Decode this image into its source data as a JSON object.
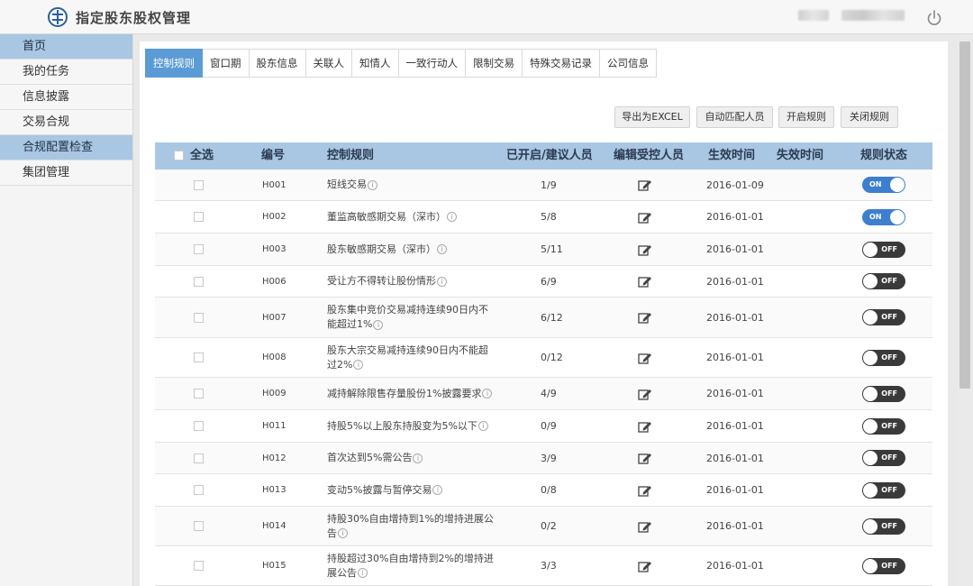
{
  "app": {
    "title": "指定股东股权管理"
  },
  "sidebar": {
    "items": [
      {
        "label": "首页",
        "active": true
      },
      {
        "label": "我的任务",
        "active": false
      },
      {
        "label": "信息披露",
        "active": false
      },
      {
        "label": "交易合规",
        "active": false
      },
      {
        "label": "合规配置检查",
        "active": true
      },
      {
        "label": "集团管理",
        "active": false
      }
    ]
  },
  "tabs": [
    {
      "label": "控制规则",
      "active": true
    },
    {
      "label": "窗口期"
    },
    {
      "label": "股东信息"
    },
    {
      "label": "关联人"
    },
    {
      "label": "知情人"
    },
    {
      "label": "一致行动人"
    },
    {
      "label": "限制交易"
    },
    {
      "label": "特殊交易记录"
    },
    {
      "label": "公司信息"
    }
  ],
  "toolbar": {
    "export": "导出为EXCEL",
    "auto_match": "自动匹配人员",
    "enable": "开启规则",
    "disable": "关闭规则"
  },
  "table": {
    "headers": {
      "select_all": "全选",
      "code": "编号",
      "rule": "控制规则",
      "count": "已开启/建议人员",
      "edit": "编辑受控人员",
      "effective": "生效时间",
      "expire": "失效时间",
      "status": "规则状态"
    },
    "rows": [
      {
        "code": "H001",
        "rule": "短线交易",
        "count": "1/9",
        "effective": "2016-01-09",
        "expire": "",
        "status": "ON"
      },
      {
        "code": "H002",
        "rule": "董监高敏感期交易（深市）",
        "count": "5/8",
        "effective": "2016-01-01",
        "expire": "",
        "status": "ON"
      },
      {
        "code": "H003",
        "rule": "股东敏感期交易（深市）",
        "count": "5/11",
        "effective": "2016-01-01",
        "expire": "",
        "status": "OFF"
      },
      {
        "code": "H006",
        "rule": "受让方不得转让股份情形",
        "count": "6/9",
        "effective": "2016-01-01",
        "expire": "",
        "status": "OFF"
      },
      {
        "code": "H007",
        "rule": "股东集中竞价交易减持连续90日内不能超过1%",
        "count": "6/12",
        "effective": "2016-01-01",
        "expire": "",
        "status": "OFF"
      },
      {
        "code": "H008",
        "rule": "股东大宗交易减持连续90日内不能超过2%",
        "count": "0/12",
        "effective": "2016-01-01",
        "expire": "",
        "status": "OFF"
      },
      {
        "code": "H009",
        "rule": "减持解除限售存量股份1%披露要求",
        "count": "4/9",
        "effective": "2016-01-01",
        "expire": "",
        "status": "OFF"
      },
      {
        "code": "H011",
        "rule": "持股5%以上股东持股变为5%以下",
        "count": "0/9",
        "effective": "2016-01-01",
        "expire": "",
        "status": "OFF"
      },
      {
        "code": "H012",
        "rule": "首次达到5%需公告",
        "count": "3/9",
        "effective": "2016-01-01",
        "expire": "",
        "status": "OFF"
      },
      {
        "code": "H013",
        "rule": "变动5%披露与暂停交易",
        "count": "0/8",
        "effective": "2016-01-01",
        "expire": "",
        "status": "OFF"
      },
      {
        "code": "H014",
        "rule": "持股30%自由增持到1%的增持进展公告",
        "count": "0/2",
        "effective": "2016-01-01",
        "expire": "",
        "status": "OFF"
      },
      {
        "code": "H015",
        "rule": "持股超过30%自由增持到2%的增持进展公告",
        "count": "3/3",
        "effective": "2016-01-01",
        "expire": "",
        "status": "OFF"
      }
    ]
  },
  "colors": {
    "accent": "#5b9bd5",
    "header_bg": "#a9c7e2",
    "toggle_on": "#3d7fcf",
    "toggle_off": "#3a3a3a"
  }
}
